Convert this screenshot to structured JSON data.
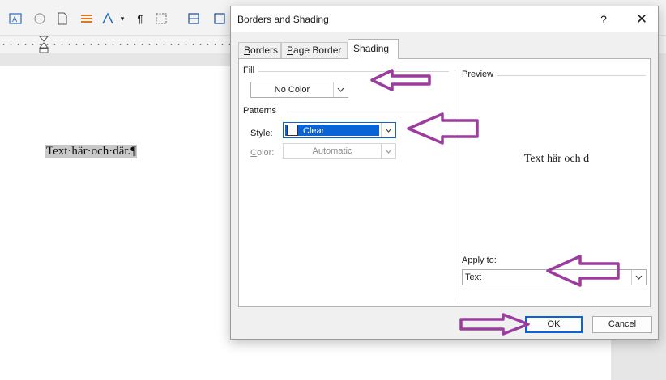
{
  "dialog": {
    "title": "Borders and Shading",
    "help_label": "?",
    "close_label": "✕",
    "tabs": [
      {
        "label_pre": "",
        "label_key": "B",
        "label_post": "orders",
        "active": false
      },
      {
        "label_pre": "",
        "label_key": "P",
        "label_post": "age Border",
        "active": false
      },
      {
        "label_pre": "",
        "label_key": "S",
        "label_post": "hading",
        "active": true
      }
    ],
    "fill": {
      "heading": "Fill",
      "value": "No Color"
    },
    "patterns": {
      "heading": "Patterns",
      "style_label_pre": "St",
      "style_label_key": "y",
      "style_label_post": "le:",
      "style_value": "Clear",
      "color_label_pre": "",
      "color_label_key": "C",
      "color_label_post": "olor:",
      "color_value": "Automatic"
    },
    "preview": {
      "heading": "Preview",
      "sample_text": "Text här och d"
    },
    "apply_to": {
      "label_pre": "App",
      "label_key": "l",
      "label_post": "y to:",
      "value": "Text"
    },
    "buttons": {
      "ok": "OK",
      "cancel": "Cancel"
    }
  },
  "document": {
    "text": "Text·här·och·där.¶"
  },
  "colors": {
    "accent": "#0a64d8",
    "annotation_arrow": "#9b3c9e"
  }
}
